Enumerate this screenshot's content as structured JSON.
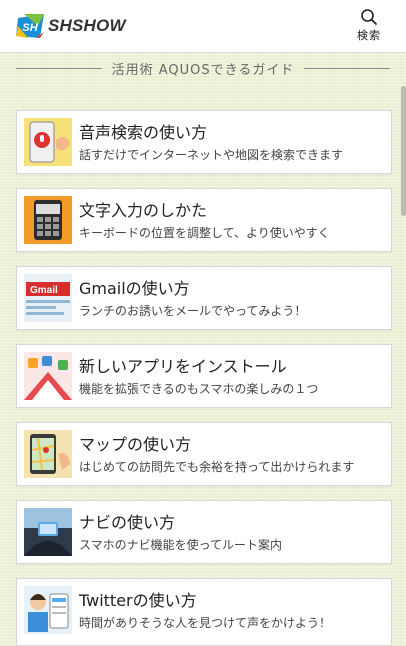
{
  "header": {
    "logo_text": "SHSHOW",
    "logo_badge": "SH",
    "search_label": "検索",
    "brand_color": "#1a8fd6"
  },
  "section": {
    "title": "活用術 AQUOSできるガイド"
  },
  "guides": [
    {
      "title": "音声検索の使い方",
      "desc": "話すだけでインターネットや地図を検索できます",
      "icon": "voice-search-thumbnail"
    },
    {
      "title": "文字入力のしかた",
      "desc": "キーボードの位置を調整して、より使いやすく",
      "icon": "keyboard-thumbnail"
    },
    {
      "title": "Gmailの使い方",
      "desc": "ランチのお誘いをメールでやってみよう！",
      "icon": "gmail-thumbnail",
      "thumb_text": "Gmail"
    },
    {
      "title": "新しいアプリをインストール",
      "desc": "機能を拡張できるのもスマホの楽しみの１つ",
      "icon": "app-install-thumbnail"
    },
    {
      "title": "マップの使い方",
      "desc": "はじめての訪問先でも余裕を持って出かけられます",
      "icon": "map-thumbnail"
    },
    {
      "title": "ナビの使い方",
      "desc": "スマホのナビ機能を使ってルート案内",
      "icon": "navigation-thumbnail"
    },
    {
      "title": "Twitterの使い方",
      "desc": "時間がありそうな人を見つけて声をかけよう！",
      "icon": "twitter-thumbnail"
    }
  ]
}
